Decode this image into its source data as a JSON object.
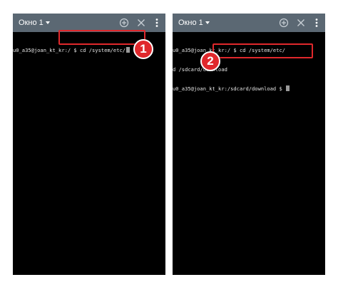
{
  "colors": {
    "titlebar": "#5b6873",
    "terminal_bg": "#000000",
    "terminal_text": "#e6e6e6",
    "highlight": "#e0282c"
  },
  "left": {
    "tab_title": "Окно 1",
    "icons": [
      "add-circle-icon",
      "close-icon",
      "more-vert-icon"
    ],
    "lines": [
      "u0_a35@joan_kt_kr:/ $ cd /system/etc/"
    ]
  },
  "right": {
    "tab_title": "Окно 1",
    "icons": [
      "add-circle-icon",
      "close-icon",
      "more-vert-icon"
    ],
    "lines": [
      "u0_a35@joan_kt_kr:/ $ cd /system/etc/",
      "d /sdcard/download",
      "u0_a35@joan_kt_kr:/sdcard/download $ "
    ]
  },
  "badges": [
    "1",
    "2"
  ]
}
